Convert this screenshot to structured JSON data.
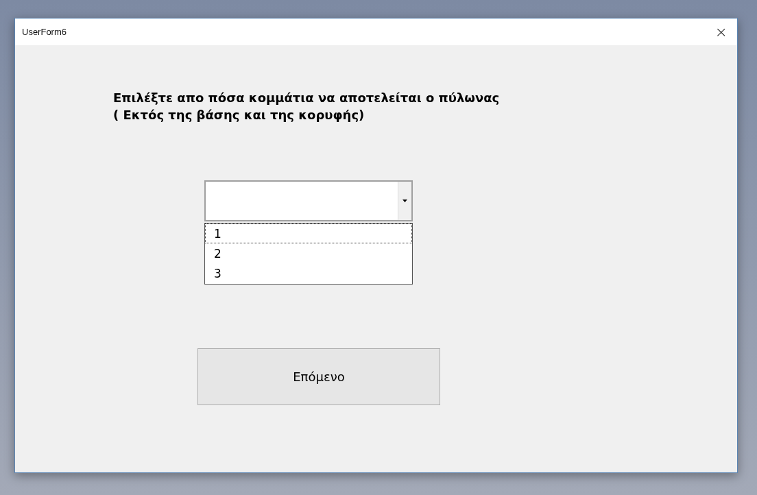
{
  "window": {
    "title": "UserForm6",
    "close": "×"
  },
  "prompt": [
    "Επιλέξτε απο πόσα κομμάτια να αποτελείται ο πύλωνας",
    "( Εκτός της βάσης και της κορυφής)"
  ],
  "combo": {
    "expanded": true,
    "options": [
      {
        "label": "1",
        "selected": true
      },
      {
        "label": "2",
        "selected": false
      },
      {
        "label": "3",
        "selected": false
      }
    ]
  },
  "buttons": [
    "Επόμενο"
  ]
}
